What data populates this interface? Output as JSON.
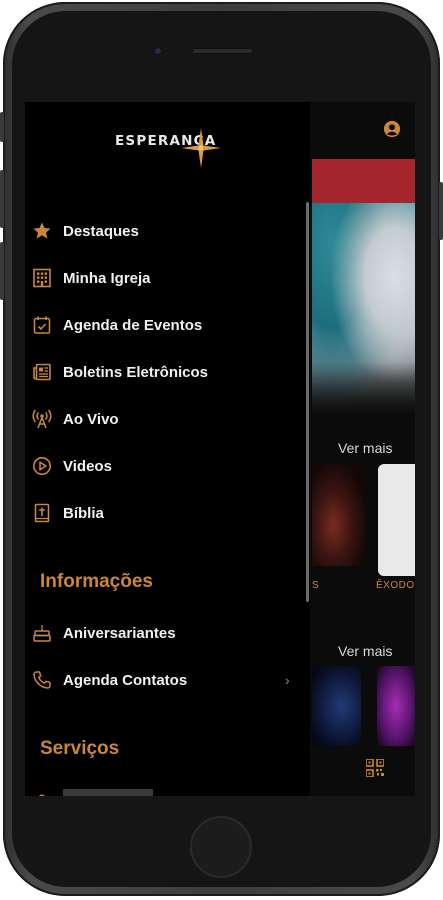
{
  "drawer": {
    "logo_text": "ESPERANÇA",
    "menu": [
      {
        "label": "Destaques",
        "icon": "star-icon"
      },
      {
        "label": "Minha Igreja",
        "icon": "building-icon"
      },
      {
        "label": "Agenda de Eventos",
        "icon": "calendar-icon"
      },
      {
        "label": "Boletins Eletrônicos",
        "icon": "newspaper-icon"
      },
      {
        "label": "Ao Vivo",
        "icon": "antenna-icon"
      },
      {
        "label": "Videos",
        "icon": "play-icon"
      },
      {
        "label": "Bíblia",
        "icon": "bible-icon"
      }
    ],
    "sections": [
      {
        "title": "Informações",
        "items": [
          {
            "label": "Aniversariantes",
            "icon": "cake-icon"
          },
          {
            "label": "Agenda Contatos",
            "icon": "phone-icon"
          }
        ]
      },
      {
        "title": "Serviços",
        "items": []
      }
    ]
  },
  "app": {
    "ver_mais_1": "Ver mais",
    "ver_mais_2": "Ver mais",
    "thumb_label": "ÊXODO",
    "thumb_label_left": "S"
  },
  "colors": {
    "accent": "#c8873a",
    "banner_red": "#a4262c",
    "background": "#000000"
  }
}
